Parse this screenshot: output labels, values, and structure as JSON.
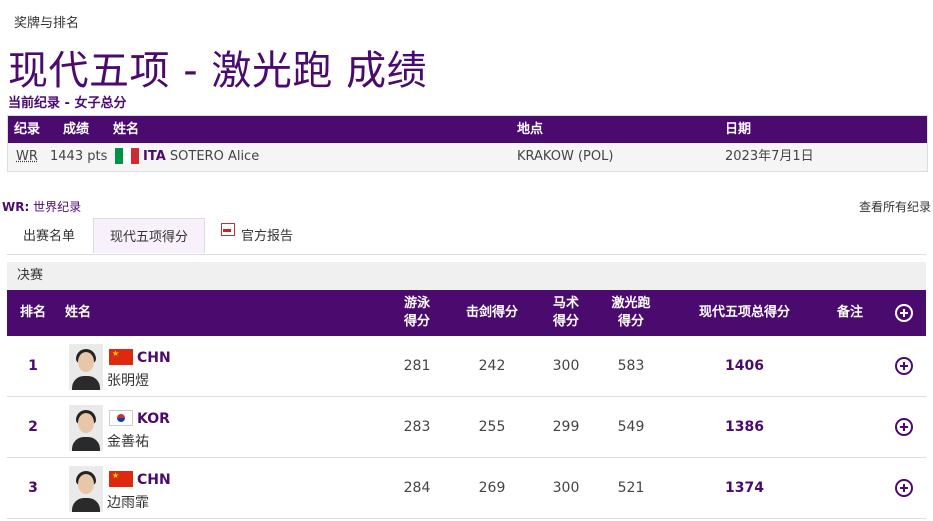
{
  "breadcrumb": "奖牌与排名",
  "title": "现代五项 - 激光跑 成绩",
  "subtitle": "当前纪录 - 女子总分",
  "records": {
    "headers": [
      "纪录",
      "成绩",
      "姓名",
      "地点",
      "日期"
    ],
    "rows": [
      {
        "type": "WR",
        "score": "1443 pts",
        "noc": "ITA",
        "name": "SOTERO Alice",
        "location": "KRAKOW (POL)",
        "date": "2023年7月1日",
        "flag": "ITA"
      }
    ]
  },
  "wr_note": {
    "abbr": "WR:",
    "text": " 世界纪录"
  },
  "all_records_link": "查看所有纪录",
  "tabs": [
    {
      "label": "出赛名单",
      "active": false
    },
    {
      "label": "现代五项得分",
      "active": true
    },
    {
      "label": "官方报告",
      "active": false,
      "icon": "pdf-icon"
    }
  ],
  "phase": "决赛",
  "results": {
    "headers": {
      "rank": "排名",
      "name": "姓名",
      "swim_l1": "游泳",
      "swim_l2": "得分",
      "fencing": "击剑得分",
      "riding_l1": "马术",
      "riding_l2": "得分",
      "laser_l1": "激光跑",
      "laser_l2": "得分",
      "total": "现代五项总得分",
      "note": "备注"
    },
    "rows": [
      {
        "rank": "1",
        "noc": "CHN",
        "name": "张明煜",
        "swim": "281",
        "fencing": "242",
        "riding": "300",
        "laser": "583",
        "total": "1406",
        "note": ""
      },
      {
        "rank": "2",
        "noc": "KOR",
        "name": "金善祐",
        "swim": "283",
        "fencing": "255",
        "riding": "299",
        "laser": "549",
        "total": "1386",
        "note": ""
      },
      {
        "rank": "3",
        "noc": "CHN",
        "name": "边雨霏",
        "swim": "284",
        "fencing": "269",
        "riding": "300",
        "laser": "521",
        "total": "1374",
        "note": ""
      }
    ]
  },
  "colors": {
    "accent": "#4b0a6e",
    "tab_active_bg": "#f8f0fa"
  }
}
